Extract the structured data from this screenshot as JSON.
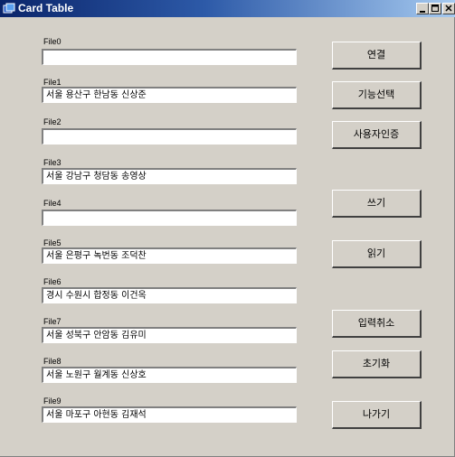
{
  "window": {
    "title": "Card Table",
    "min_label": "_",
    "max_label": "□",
    "close_label": "×"
  },
  "fields": [
    {
      "label": "File0",
      "value": ""
    },
    {
      "label": "File1",
      "value": "서울 용산구 한남동 신상준"
    },
    {
      "label": "File2",
      "value": ""
    },
    {
      "label": "File3",
      "value": "서울 강남구 청담동 송영상"
    },
    {
      "label": "File4",
      "value": ""
    },
    {
      "label": "File5",
      "value": "서울 은평구 녹번동 조덕찬"
    },
    {
      "label": "File6",
      "value": "경시 수원시 합정동 이건옥"
    },
    {
      "label": "File7",
      "value": "서울 성북구 안암동 김유미"
    },
    {
      "label": "File8",
      "value": "서울 노원구 월계동 신상호"
    },
    {
      "label": "File9",
      "value": "서울 마포구 아현동 김재석"
    }
  ],
  "buttons": {
    "connect": "연결",
    "select_function": "기능선택",
    "user_auth": "사용자인증",
    "write": "쓰기",
    "read": "읽기",
    "cancel_input": "입력취소",
    "reset": "초기화",
    "exit": "나가기"
  },
  "colors": {
    "title_gradient_start": "#0a246a",
    "title_gradient_end": "#a6caf0",
    "face": "#d4d0c8"
  }
}
